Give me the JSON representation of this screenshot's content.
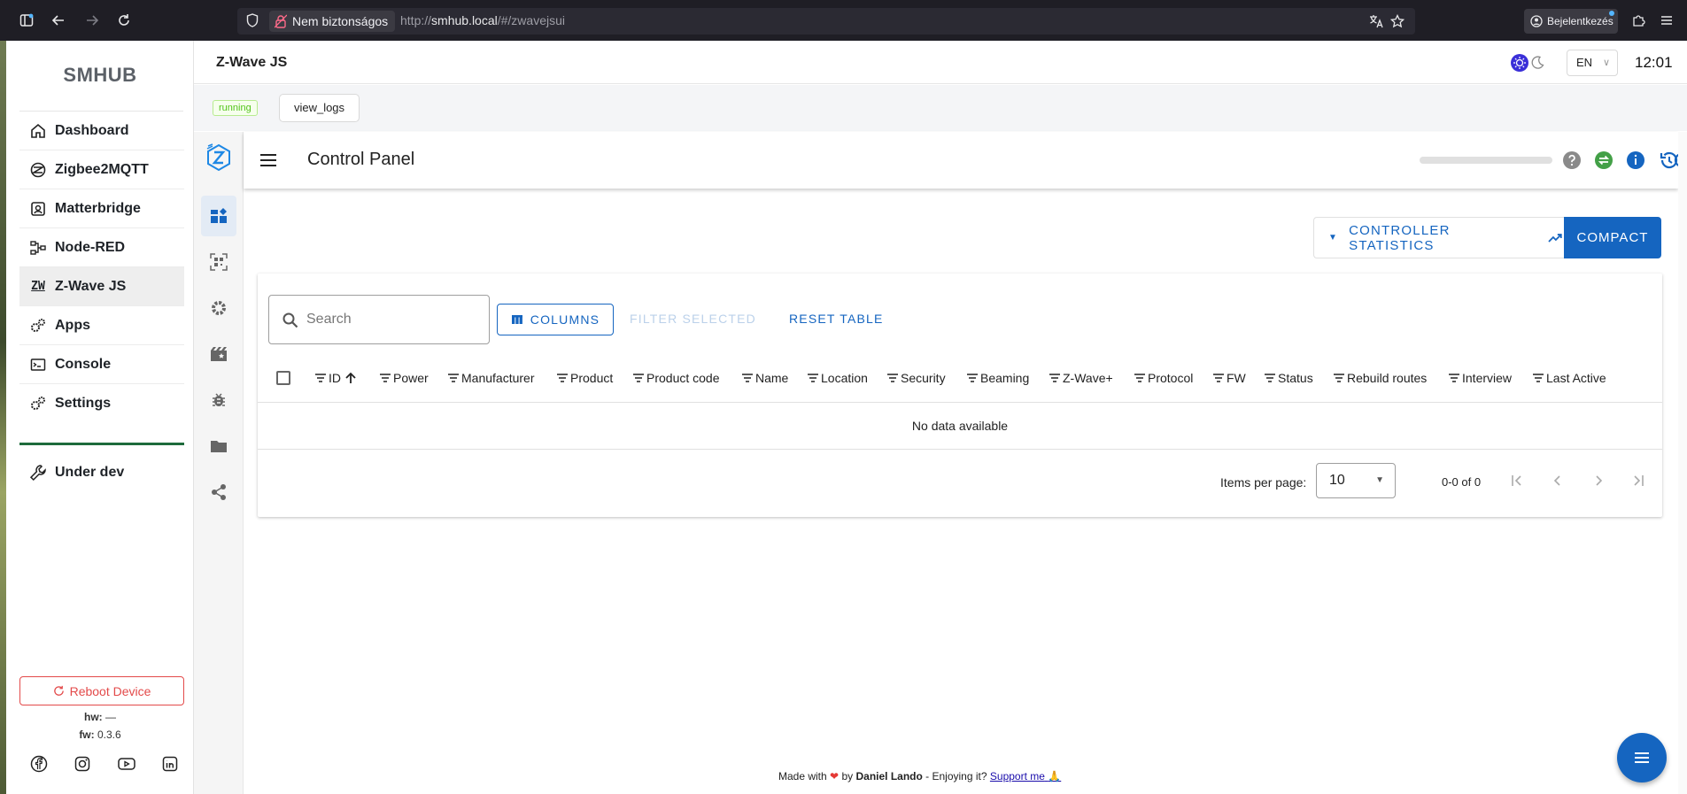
{
  "browser": {
    "insecure_label": "Nem biztonságos",
    "url_prefix": "http://",
    "url_host": "smhub.local",
    "url_path": "/#/zwavejsui",
    "signin_label": "Bejelentkezés"
  },
  "sidebar": {
    "brand": "SMHUB",
    "items": [
      {
        "label": "Dashboard",
        "icon": "home-icon"
      },
      {
        "label": "Zigbee2MQTT",
        "icon": "zigbee-icon"
      },
      {
        "label": "Matterbridge",
        "icon": "matter-icon"
      },
      {
        "label": "Node-RED",
        "icon": "node-red-icon"
      },
      {
        "label": "Z-Wave JS",
        "icon": "zwave-icon",
        "icon_text": "ZW",
        "active": true
      },
      {
        "label": "Apps",
        "icon": "apps-icon"
      },
      {
        "label": "Console",
        "icon": "console-icon"
      },
      {
        "label": "Settings",
        "icon": "gear-icon"
      }
    ],
    "under_dev": "Under dev",
    "reboot_label": "Reboot Device",
    "hw_label": "hw:",
    "hw_value": "—",
    "fw_label": "fw:",
    "fw_value": "0.3.6"
  },
  "header": {
    "title": "Z-Wave JS",
    "lang": "EN",
    "time": "12:01"
  },
  "status": {
    "state": "running",
    "logs_button": "view_logs"
  },
  "zwave": {
    "toolbar_title": "Control Panel",
    "controller_stats_label": "CONTROLLER STATISTICS",
    "compact_label": "COMPACT",
    "search_placeholder": "Search",
    "columns_label": "COLUMNS",
    "filter_selected_label": "FILTER SELECTED",
    "reset_table_label": "RESET TABLE",
    "columns": [
      "ID",
      "Power",
      "Manufacturer",
      "Product",
      "Product code",
      "Name",
      "Location",
      "Security",
      "Beaming",
      "Z-Wave+",
      "Protocol",
      "FW",
      "Status",
      "Rebuild routes",
      "Interview",
      "Last Active"
    ],
    "no_data": "No data available",
    "items_per_page_label": "Items per page:",
    "items_per_page": "10",
    "range": "0-0 of 0"
  },
  "footer": {
    "made_with": "Made with",
    "by": "by",
    "author": "Daniel Lando",
    "enjoying": "- Enjoying it?",
    "support": "Support me",
    "support_emoji": "🙏"
  },
  "colors": {
    "accent": "#1565c0",
    "running": "#52c41a",
    "reboot": "#e34a4a",
    "green_divider": "#1e6b3c"
  }
}
